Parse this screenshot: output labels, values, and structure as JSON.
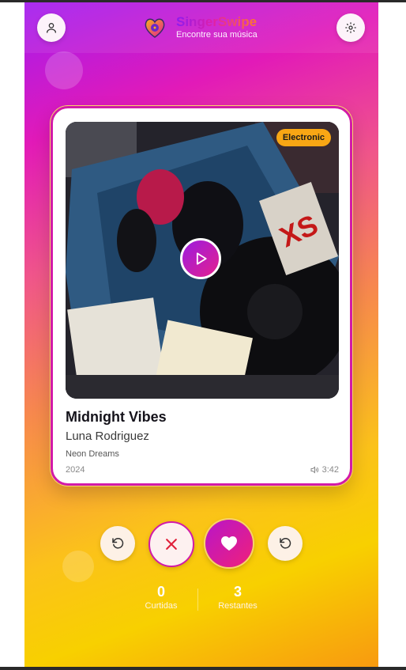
{
  "header": {
    "title_part1": "Singer",
    "title_part2": "Swipe",
    "subtitle": "Encontre sua música",
    "profile_icon": "user-icon",
    "settings_icon": "gear-icon"
  },
  "card": {
    "genre": "Electronic",
    "song_title": "Midnight Vibes",
    "artist": "Luna Rodriguez",
    "album": "Neon Dreams",
    "year": "2024",
    "duration": "3:42",
    "play_icon": "play-icon",
    "volume_icon": "volume-icon"
  },
  "controls": {
    "undo_left_icon": "undo-icon",
    "dislike_icon": "close-icon",
    "like_icon": "heart-icon",
    "undo_right_icon": "undo-icon"
  },
  "stats": {
    "liked_count": "0",
    "liked_label": "Curtidas",
    "remaining_count": "3",
    "remaining_label": "Restantes"
  },
  "colors": {
    "accent_purple": "#a21cf0",
    "accent_pink": "#e21ab8",
    "accent_yellow": "#f8d000",
    "genre_badge": "#f8a614"
  }
}
